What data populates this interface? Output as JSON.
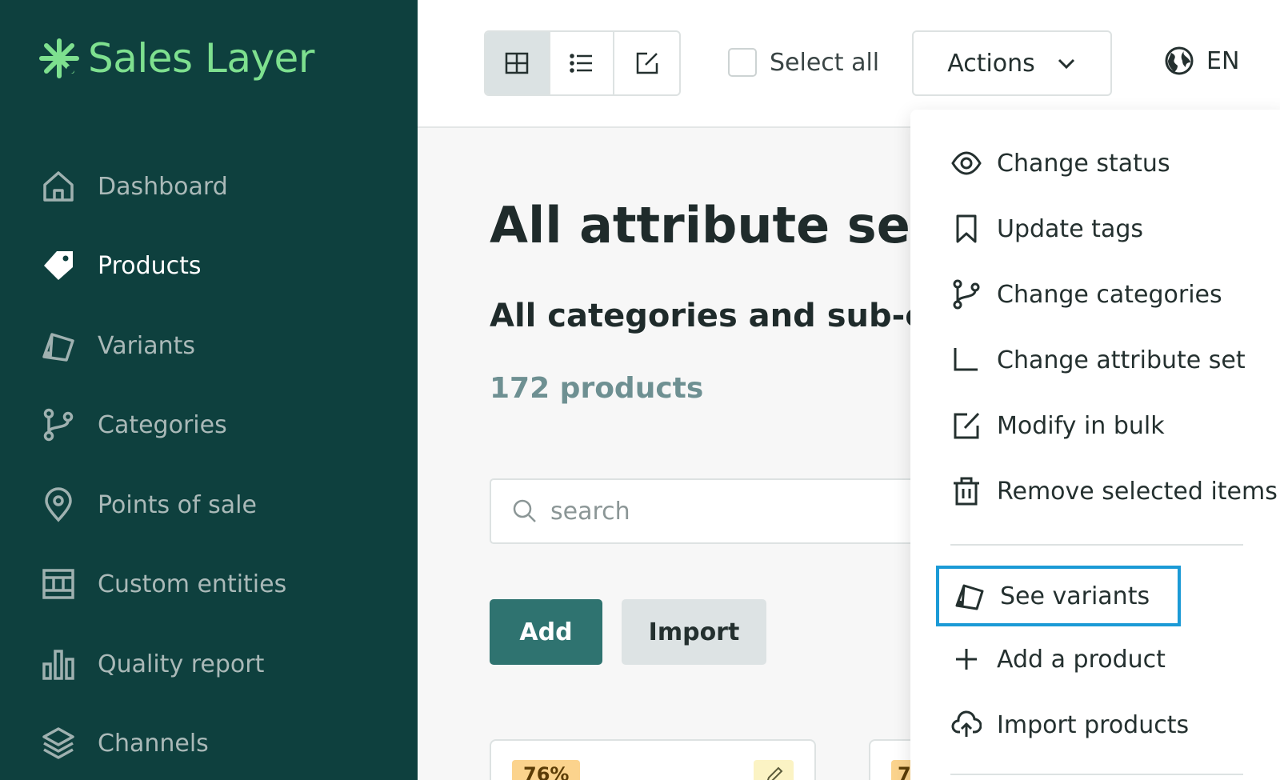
{
  "brand": {
    "name": "Sales Layer",
    "color": "#7ee08f"
  },
  "sidebar": {
    "items": [
      {
        "label": "Dashboard",
        "icon": "home-icon"
      },
      {
        "label": "Products",
        "icon": "tag-icon",
        "active": true
      },
      {
        "label": "Variants",
        "icon": "swatch-icon"
      },
      {
        "label": "Categories",
        "icon": "branch-icon"
      },
      {
        "label": "Points of sale",
        "icon": "location-pin-icon"
      },
      {
        "label": "Custom entities",
        "icon": "columns-icon"
      },
      {
        "label": "Quality report",
        "icon": "bar-chart-icon"
      },
      {
        "label": "Channels",
        "icon": "layers-icon"
      }
    ]
  },
  "toolbar": {
    "views": [
      "grid-view-icon",
      "list-view-icon",
      "edit-view-icon"
    ],
    "select_all_label": "Select all",
    "actions_label": "Actions",
    "language": "EN"
  },
  "main": {
    "title": "All attribute sets",
    "subtitle": "All categories and sub-cate",
    "count": "172 products",
    "search_placeholder": "search",
    "add_label": "Add",
    "import_label": "Import",
    "cards": [
      {
        "badge": "76%"
      },
      {
        "badge": "7"
      }
    ]
  },
  "actions_menu": {
    "items": [
      {
        "label": "Change status",
        "icon": "eye-icon"
      },
      {
        "label": "Update tags",
        "icon": "bookmark-icon"
      },
      {
        "label": "Change categories",
        "icon": "branch-icon"
      },
      {
        "label": "Change attribute set",
        "icon": "corner-icon"
      },
      {
        "label": "Modify in bulk",
        "icon": "edit-icon"
      },
      {
        "label": "Remove selected items",
        "icon": "trash-icon"
      },
      {
        "label": "See variants",
        "icon": "swatch-icon",
        "highlighted": true
      },
      {
        "label": "Add a product",
        "icon": "plus-icon"
      },
      {
        "label": "Import products",
        "icon": "cloud-upload-icon"
      }
    ]
  },
  "colors": {
    "sidebar_bg": "#0e403e",
    "primary": "#2f7370",
    "highlight_border": "#1b9ad6",
    "badge_bg": "#fbd38d"
  }
}
